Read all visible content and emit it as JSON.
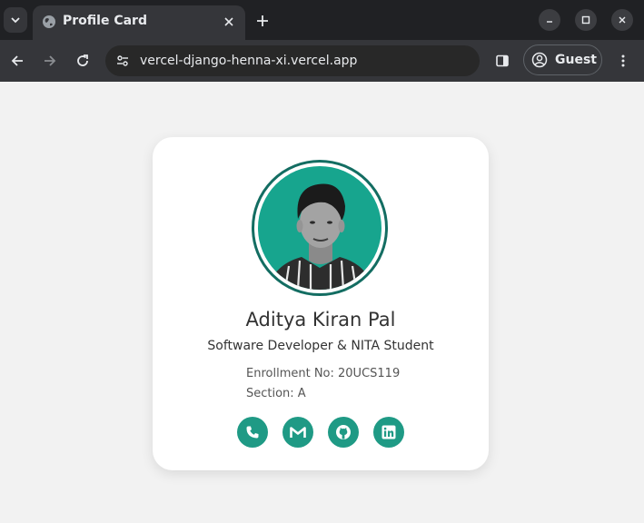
{
  "browser": {
    "tab": {
      "title": "Profile Card",
      "favicon": "globe-icon"
    },
    "url": "vercel-django-henna-xi.vercel.app",
    "profile_label": "Guest",
    "icons": {
      "tab_search": "chevron-down-icon",
      "tab_close": "close-icon",
      "new_tab": "plus-icon",
      "minimize": "minimize-icon",
      "maximize": "maximize-icon",
      "close_window": "close-icon",
      "back": "back-arrow-icon",
      "forward": "forward-arrow-icon",
      "reload": "reload-icon",
      "site_info": "tune-icon",
      "side_panel": "side-panel-icon",
      "profile": "account-circle-icon",
      "menu": "kebab-menu-icon"
    },
    "colors": {
      "frame": "#202124",
      "toolbar": "#35363a",
      "omnibox": "#282828"
    }
  },
  "card": {
    "name": "Aditya Kiran Pal",
    "title": "Software Developer & NITA Student",
    "details": [
      {
        "text": "Enrollment No: 20UCS119"
      },
      {
        "text": "Section: A"
      }
    ],
    "socials": [
      {
        "icon": "phone-icon"
      },
      {
        "icon": "gmail-icon"
      },
      {
        "icon": "github-icon"
      },
      {
        "icon": "linkedin-icon"
      }
    ],
    "colors": {
      "accent": "#1f9a85",
      "avatar_bg": "#17a58e",
      "ring": "#136d62"
    }
  }
}
